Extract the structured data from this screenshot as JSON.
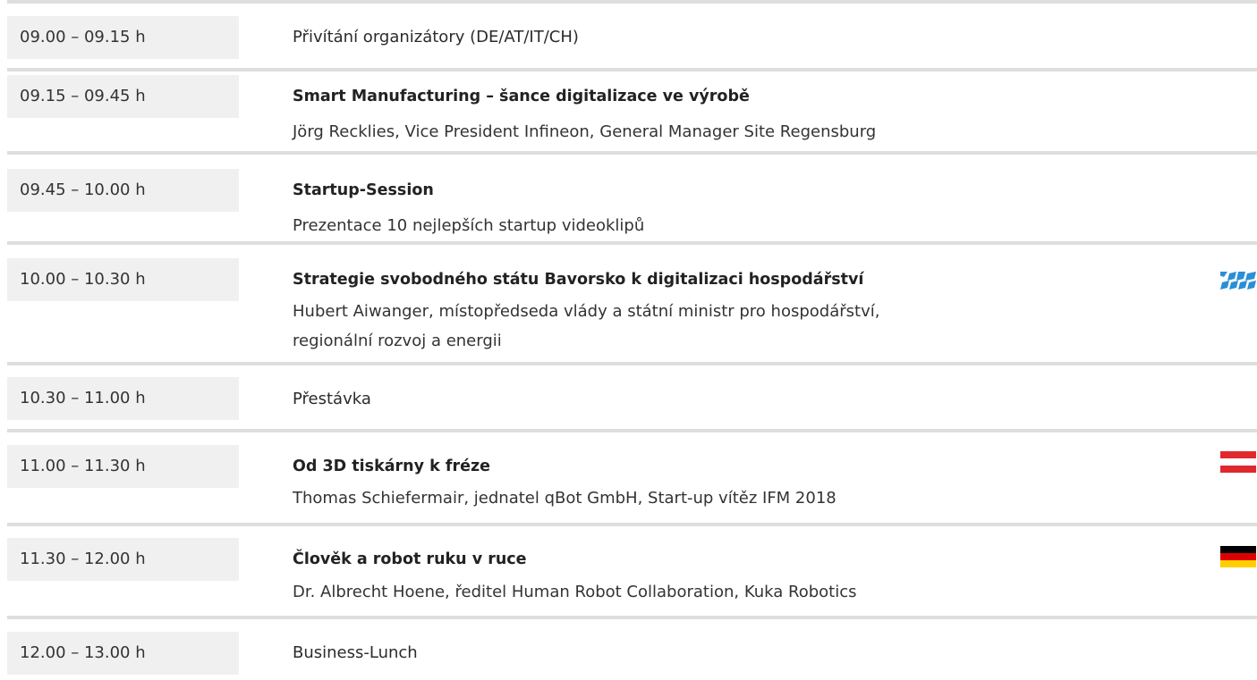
{
  "rows": [
    {
      "time": "09.00 – 09.15 h",
      "title": "Přivítání organizátory (DE/AT/IT/CH)"
    },
    {
      "time": "09.15 – 09.45 h",
      "title": "Smart Manufacturing – šance digitalizace ve výrobě",
      "sub1": "Jörg Recklies, Vice President Infineon, General Manager Site Regensburg"
    },
    {
      "time": "09.45 – 10.00 h",
      "title": "Startup-Session",
      "sub1": "Prezentace 10 nejlepších startup videoklipů"
    },
    {
      "time": "10.00 – 10.30 h",
      "title": "Strategie svobodného státu Bavorsko k digitalizaci hospodářství",
      "sub1": "Hubert Aiwanger, místopředseda vlády a státní ministr pro hospodářství,",
      "sub2": "regionální rozvoj a energii",
      "flag": "bavaria-flag-icon"
    },
    {
      "time": "10.30 – 11.00 h",
      "title": "Přestávka"
    },
    {
      "time": "11.00 – 11.30 h",
      "title": "Od 3D tiskárny k fréze",
      "sub1": "Thomas Schiefermair, jednatel qBot GmbH, Start-up vítěz IFM 2018",
      "flag": "austria-flag-icon"
    },
    {
      "time": "11.30 – 12.00 h",
      "title": "Člověk a robot ruku v ruce",
      "sub1": "Dr. Albrecht Hoene, ředitel Human Robot Collaboration, Kuka Robotics",
      "flag": "germany-flag-icon"
    },
    {
      "time": "12.00 – 13.00 h",
      "title": "Business-Lunch"
    }
  ],
  "colors": {
    "rule": "#dedede",
    "time_bg": "#f0f0f0",
    "bavaria_blue": "#2a8fd6",
    "austria_red": "#e0292f",
    "germany_black": "#000000",
    "germany_red": "#dd0000",
    "germany_gold": "#ffce00"
  }
}
